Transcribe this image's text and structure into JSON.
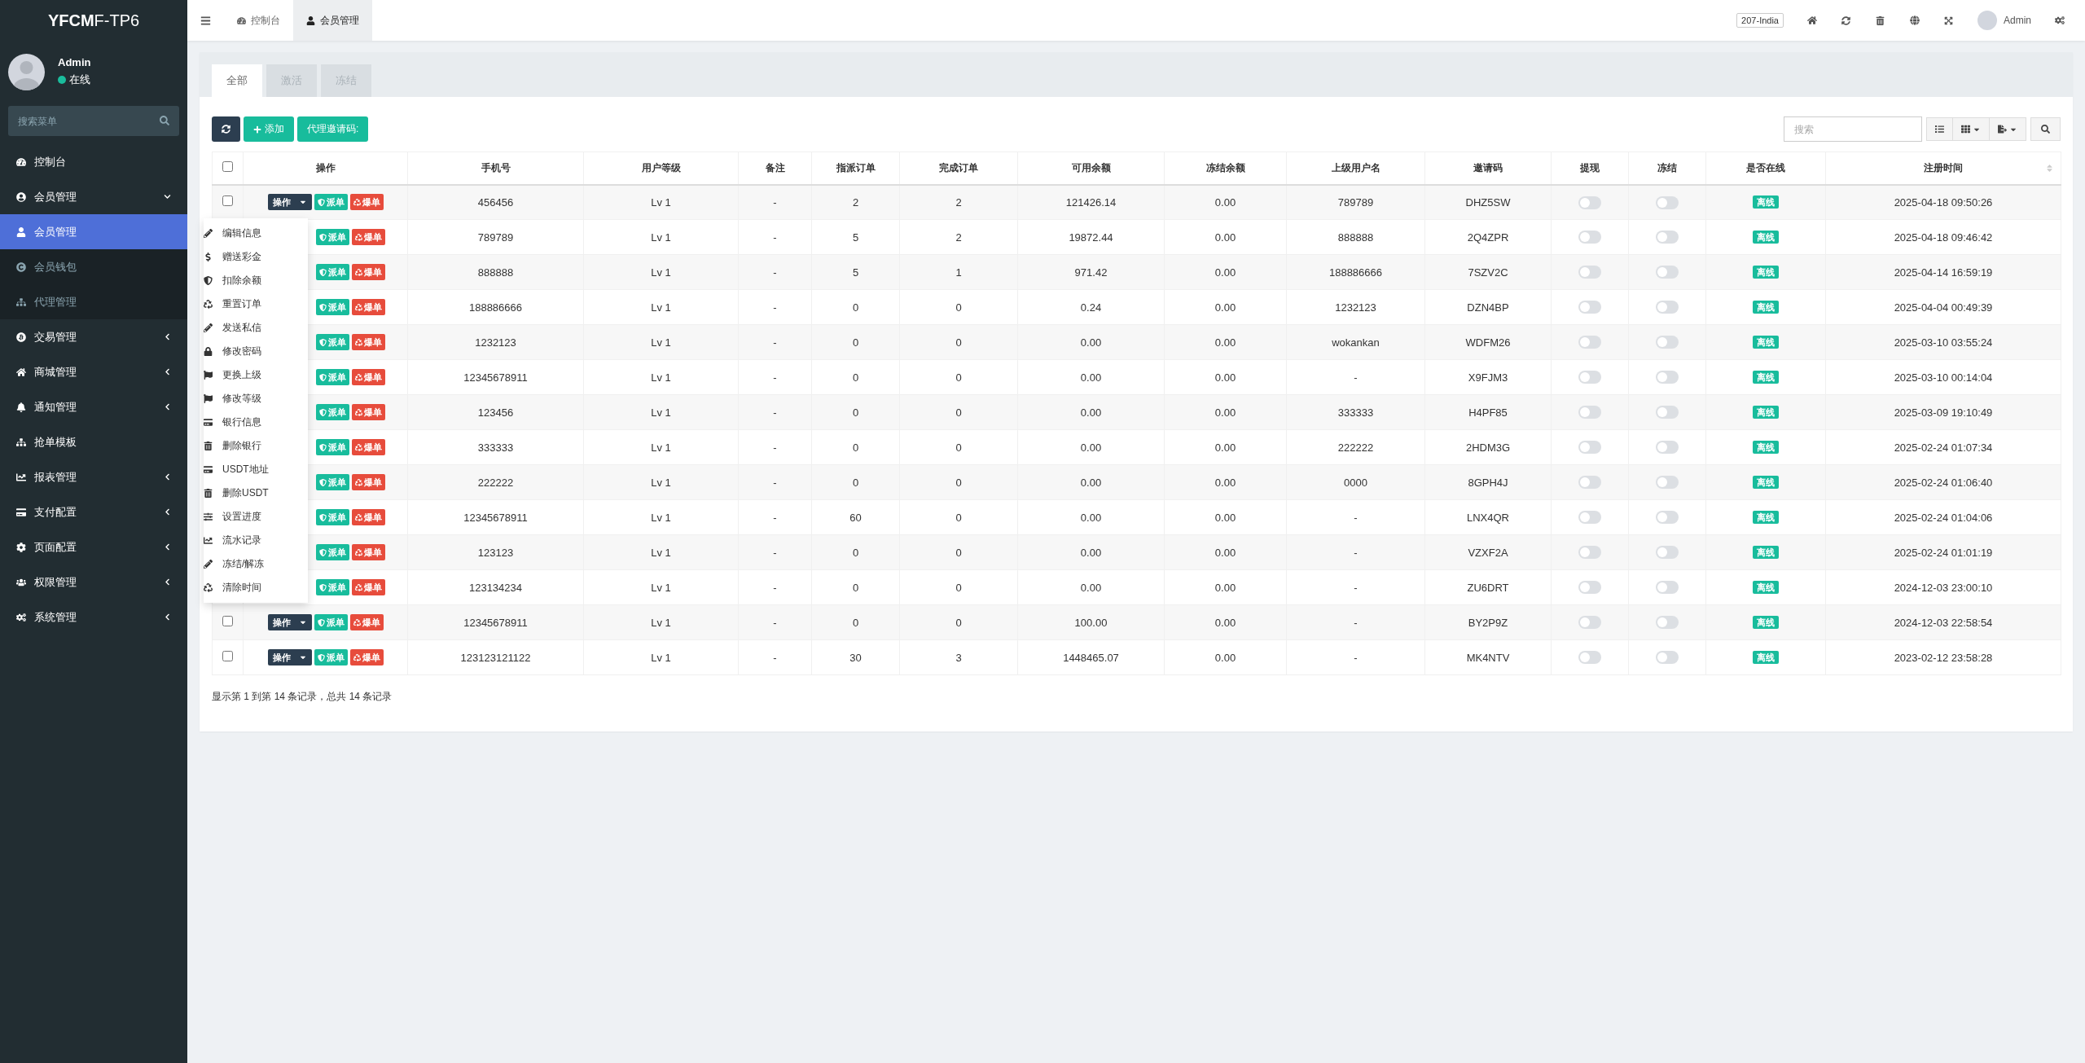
{
  "sidebar": {
    "logo": "**YFCM**F-TP6",
    "user": {
      "name": "Admin",
      "status": "在线"
    },
    "search": {
      "placeholder": "搜索菜单"
    },
    "items": [
      {
        "label": "控制台",
        "kind": "dashboard",
        "has_children": false
      },
      {
        "label": "会员管理",
        "kind": "member",
        "expanded": true,
        "has_children": true,
        "children": [
          {
            "label": "会员管理",
            "kind": "user",
            "selected": true
          },
          {
            "label": "会员钱包",
            "kind": "wallet",
            "selected": false
          },
          {
            "label": "代理管理",
            "kind": "tree",
            "selected": false
          }
        ]
      },
      {
        "label": "交易管理",
        "kind": "bitcoin",
        "expanded": false,
        "has_children": true
      },
      {
        "label": "商城管理",
        "kind": "home",
        "expanded": false,
        "has_children": true
      },
      {
        "label": "通知管理",
        "kind": "bell",
        "expanded": false,
        "has_children": true
      },
      {
        "label": "抢单模板",
        "kind": "tree",
        "has_children": false
      },
      {
        "label": "报表管理",
        "kind": "chart",
        "expanded": false,
        "has_children": true
      },
      {
        "label": "支付配置",
        "kind": "card",
        "expanded": false,
        "has_children": true
      },
      {
        "label": "页面配置",
        "kind": "gear",
        "expanded": false,
        "has_children": true
      },
      {
        "label": "权限管理",
        "kind": "users",
        "expanded": false,
        "has_children": true
      },
      {
        "label": "系统管理",
        "kind": "gears",
        "expanded": false,
        "has_children": true
      }
    ]
  },
  "topbar": {
    "tabs": [
      {
        "label": "控制台",
        "kind": "dashboard",
        "selected": false
      },
      {
        "label": "会员管理",
        "kind": "user",
        "selected": true
      }
    ],
    "server_badge": "207-India",
    "user": "Admin"
  },
  "content_tabs": [
    {
      "label": "全部",
      "selected": true
    },
    {
      "label": "激活",
      "selected": false
    },
    {
      "label": "冻结",
      "selected": false
    }
  ],
  "toolbar": {
    "add": "添加",
    "invite": "代理邀请码:",
    "search": {
      "placeholder": "搜索"
    }
  },
  "table": {
    "header_checkbox": {
      "checked": false
    },
    "columns": [
      {
        "label": "操作",
        "sortable": false
      },
      {
        "label": "手机号",
        "sortable": false
      },
      {
        "label": "用户等级",
        "sortable": false
      },
      {
        "label": "备注",
        "sortable": false
      },
      {
        "label": "指派订单",
        "sortable": false
      },
      {
        "label": "完成订单",
        "sortable": false
      },
      {
        "label": "可用余额",
        "sortable": false
      },
      {
        "label": "冻结余额",
        "sortable": false
      },
      {
        "label": "上级用户名",
        "sortable": false
      },
      {
        "label": "邀请码",
        "sortable": false
      },
      {
        "label": "提现",
        "sortable": false
      },
      {
        "label": "冻结",
        "sortable": false
      },
      {
        "label": "是否在线",
        "sortable": false
      },
      {
        "label": "注册时间",
        "sortable": true
      }
    ],
    "rows": [
      {
        "checked": false,
        "menu_label": "操作",
        "dispatch": "派单",
        "burst": "爆单",
        "phone": "456456",
        "level": "Lv 1",
        "note": "-",
        "assigned": "2",
        "completed": "2",
        "balance": "121426.14",
        "frozen": "0.00",
        "parent": "789789",
        "invite": "DHZ5SW",
        "withdraw": false,
        "freeze": false,
        "online": "离线",
        "registered": "2025-04-18 09:50:26"
      },
      {
        "dispatch": "派单",
        "burst": "爆单",
        "phone": "789789",
        "level": "Lv 1",
        "note": "-",
        "assigned": "5",
        "completed": "2",
        "balance": "19872.44",
        "frozen": "0.00",
        "parent": "888888",
        "invite": "2Q4ZPR",
        "withdraw": false,
        "freeze": false,
        "online": "离线",
        "registered": "2025-04-18 09:46:42"
      },
      {
        "dispatch": "派单",
        "burst": "爆单",
        "phone": "888888",
        "level": "Lv 1",
        "note": "-",
        "assigned": "5",
        "completed": "1",
        "balance": "971.42",
        "frozen": "0.00",
        "parent": "188886666",
        "invite": "7SZV2C",
        "withdraw": false,
        "freeze": false,
        "online": "离线",
        "registered": "2025-04-14 16:59:19"
      },
      {
        "dispatch": "派单",
        "burst": "爆单",
        "phone": "188886666",
        "level": "Lv 1",
        "note": "-",
        "assigned": "0",
        "completed": "0",
        "balance": "0.24",
        "frozen": "0.00",
        "parent": "1232123",
        "invite": "DZN4BP",
        "withdraw": false,
        "freeze": false,
        "online": "离线",
        "registered": "2025-04-04 00:49:39"
      },
      {
        "dispatch": "派单",
        "burst": "爆单",
        "phone": "1232123",
        "level": "Lv 1",
        "note": "-",
        "assigned": "0",
        "completed": "0",
        "balance": "0.00",
        "frozen": "0.00",
        "parent": "wokankan",
        "invite": "WDFM26",
        "withdraw": false,
        "freeze": false,
        "online": "离线",
        "registered": "2025-03-10 03:55:24"
      },
      {
        "dispatch": "派单",
        "burst": "爆单",
        "phone": "12345678911",
        "level": "Lv 1",
        "note": "-",
        "assigned": "0",
        "completed": "0",
        "balance": "0.00",
        "frozen": "0.00",
        "parent": "-",
        "invite": "X9FJM3",
        "withdraw": false,
        "freeze": false,
        "online": "离线",
        "registered": "2025-03-10 00:14:04"
      },
      {
        "dispatch": "派单",
        "burst": "爆单",
        "phone": "123456",
        "level": "Lv 1",
        "note": "-",
        "assigned": "0",
        "completed": "0",
        "balance": "0.00",
        "frozen": "0.00",
        "parent": "333333",
        "invite": "H4PF85",
        "withdraw": false,
        "freeze": false,
        "online": "离线",
        "registered": "2025-03-09 19:10:49"
      },
      {
        "dispatch": "派单",
        "burst": "爆单",
        "phone": "333333",
        "level": "Lv 1",
        "note": "-",
        "assigned": "0",
        "completed": "0",
        "balance": "0.00",
        "frozen": "0.00",
        "parent": "222222",
        "invite": "2HDM3G",
        "withdraw": false,
        "freeze": false,
        "online": "离线",
        "registered": "2025-02-24 01:07:34"
      },
      {
        "dispatch": "派单",
        "burst": "爆单",
        "phone": "222222",
        "level": "Lv 1",
        "note": "-",
        "assigned": "0",
        "completed": "0",
        "balance": "0.00",
        "frozen": "0.00",
        "parent": "0000",
        "invite": "8GPH4J",
        "withdraw": false,
        "freeze": false,
        "online": "离线",
        "registered": "2025-02-24 01:06:40"
      },
      {
        "dispatch": "派单",
        "burst": "爆单",
        "phone": "12345678911",
        "level": "Lv 1",
        "note": "-",
        "assigned": "60",
        "completed": "0",
        "balance": "0.00",
        "frozen": "0.00",
        "parent": "-",
        "invite": "LNX4QR",
        "withdraw": false,
        "freeze": false,
        "online": "离线",
        "registered": "2025-02-24 01:04:06"
      },
      {
        "dispatch": "派单",
        "burst": "爆单",
        "phone": "123123",
        "level": "Lv 1",
        "note": "-",
        "assigned": "0",
        "completed": "0",
        "balance": "0.00",
        "frozen": "0.00",
        "parent": "-",
        "invite": "VZXF2A",
        "withdraw": false,
        "freeze": false,
        "online": "离线",
        "registered": "2025-02-24 01:01:19"
      },
      {
        "dispatch": "派单",
        "burst": "爆单",
        "phone": "123134234",
        "level": "Lv 1",
        "note": "-",
        "assigned": "0",
        "completed": "0",
        "balance": "0.00",
        "frozen": "0.00",
        "parent": "-",
        "invite": "ZU6DRT",
        "withdraw": false,
        "freeze": false,
        "online": "离线",
        "registered": "2024-12-03 23:00:10"
      },
      {
        "checked": false,
        "menu_label": "操作",
        "dispatch": "派单",
        "burst": "爆单",
        "phone": "12345678911",
        "level": "Lv 1",
        "note": "-",
        "assigned": "0",
        "completed": "0",
        "balance": "100.00",
        "frozen": "0.00",
        "parent": "-",
        "invite": "BY2P9Z",
        "withdraw": false,
        "freeze": false,
        "online": "离线",
        "registered": "2024-12-03 22:58:54"
      },
      {
        "checked": false,
        "menu_label": "操作",
        "dispatch": "派单",
        "burst": "爆单",
        "phone": "123123121122",
        "level": "Lv 1",
        "note": "-",
        "assigned": "30",
        "completed": "3",
        "balance": "1448465.07",
        "frozen": "0.00",
        "parent": "-",
        "invite": "MK4NTV",
        "withdraw": false,
        "freeze": false,
        "online": "离线",
        "registered": "2023-02-12 23:58:28"
      }
    ],
    "summary": "显示第 1 到第 14 条记录，总共 14 条记录"
  },
  "action_menu": {
    "items": [
      {
        "label": "编辑信息",
        "kind": "pencil"
      },
      {
        "label": "赠送彩金",
        "kind": "dollar"
      },
      {
        "label": "扣除余额",
        "kind": "shield"
      },
      {
        "label": "重置订单",
        "kind": "recycle"
      },
      {
        "label": "发送私信",
        "kind": "pencil"
      },
      {
        "label": "修改密码",
        "kind": "lock"
      },
      {
        "label": "更换上级",
        "kind": "flag"
      },
      {
        "label": "修改等级",
        "kind": "flag"
      },
      {
        "label": "银行信息",
        "kind": "card"
      },
      {
        "label": "删除银行",
        "kind": "trash"
      },
      {
        "label": "USDT地址",
        "kind": "card"
      },
      {
        "label": "删除USDT",
        "kind": "trash"
      },
      {
        "label": "设置进度",
        "kind": "sliders"
      },
      {
        "label": "流水记录",
        "kind": "chart"
      },
      {
        "label": "冻结/解冻",
        "kind": "pencil"
      },
      {
        "label": "清除时间",
        "kind": "recycle"
      }
    ]
  }
}
